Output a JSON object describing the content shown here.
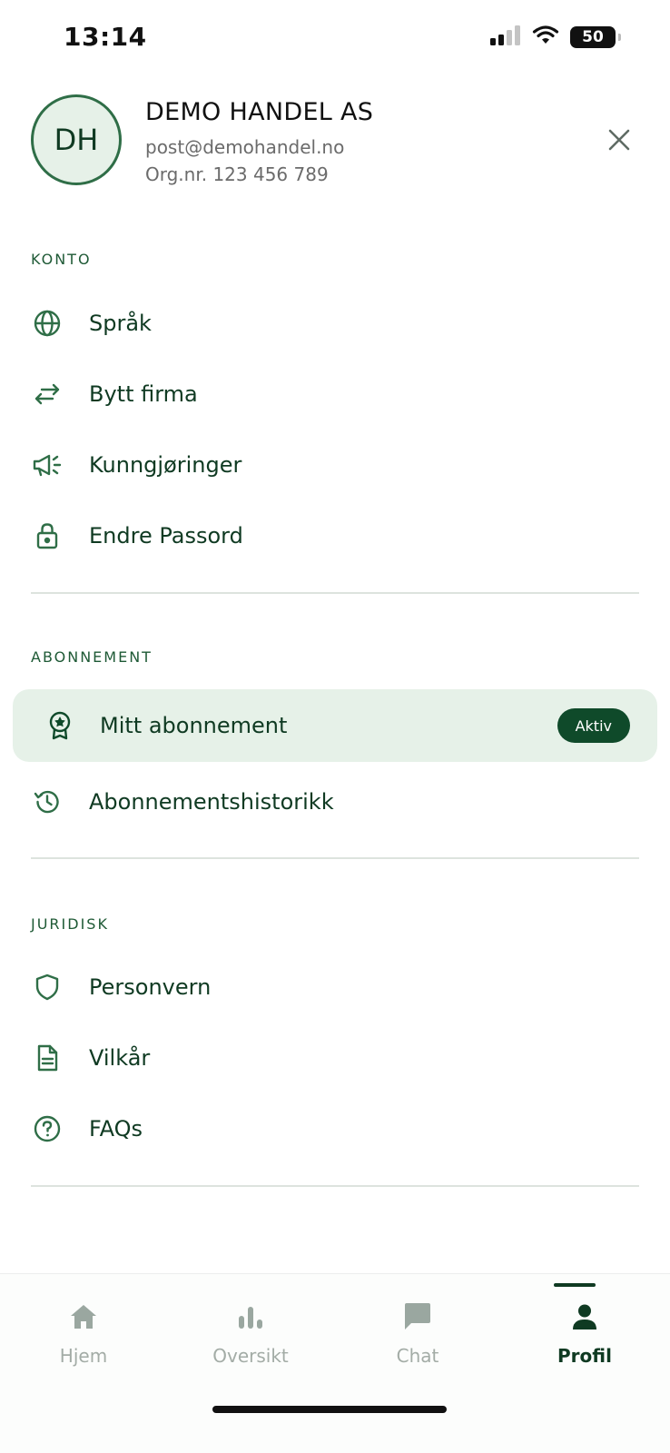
{
  "status_bar": {
    "time": "13:14",
    "battery": "50",
    "icons": [
      "signal-icon",
      "wifi-icon",
      "battery-icon"
    ]
  },
  "profile": {
    "initials": "DH",
    "company_name": "DEMO HANDEL AS",
    "email": "post@demohandel.no",
    "org_number": "Org.nr. 123 456 789"
  },
  "sections": {
    "konto": {
      "title": "KONTO",
      "items": [
        {
          "label": "Språk",
          "icon": "globe-icon"
        },
        {
          "label": "Bytt firma",
          "icon": "swap-arrows-icon"
        },
        {
          "label": "Kunngjøringer",
          "icon": "megaphone-icon"
        },
        {
          "label": "Endre Passord",
          "icon": "lock-icon"
        }
      ]
    },
    "abonnement": {
      "title": "ABONNEMENT",
      "items": [
        {
          "label": "Mitt abonnement",
          "icon": "award-icon",
          "badge": "Aktiv"
        },
        {
          "label": "Abonnementshistorikk",
          "icon": "history-icon"
        }
      ]
    },
    "juridisk": {
      "title": "JURIDISK",
      "items": [
        {
          "label": "Personvern",
          "icon": "shield-icon"
        },
        {
          "label": "Vilkår",
          "icon": "document-icon"
        },
        {
          "label": "FAQs",
          "icon": "help-circle-icon"
        }
      ]
    }
  },
  "tab_bar": {
    "tabs": [
      {
        "label": "Hjem",
        "icon": "home-icon"
      },
      {
        "label": "Oversikt",
        "icon": "bar-chart-icon"
      },
      {
        "label": "Chat",
        "icon": "chat-bubble-icon"
      },
      {
        "label": "Profil",
        "icon": "person-icon"
      }
    ],
    "active": "Profil"
  },
  "colors": {
    "primary": "#0f3a22",
    "accent": "#2f6e47",
    "highlight_bg": "#e6f1e8",
    "badge_bg": "#0f4a2a",
    "muted": "#a3aca6"
  }
}
